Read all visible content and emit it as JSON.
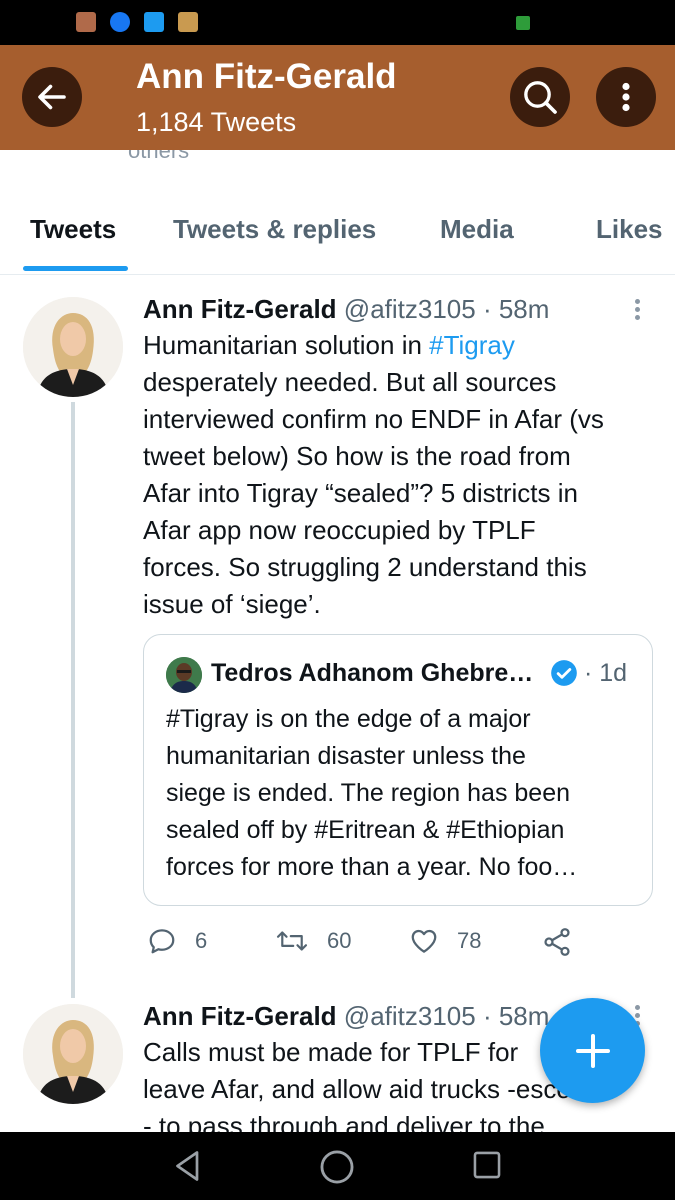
{
  "header": {
    "name": "Ann Fitz-Gerald",
    "tweet_count": "1,184 Tweets"
  },
  "profile_fragment": {
    "text": "others"
  },
  "tabs": [
    {
      "label": "Tweets",
      "active": true
    },
    {
      "label": "Tweets & replies",
      "active": false
    },
    {
      "label": "Media",
      "active": false
    },
    {
      "label": "Likes",
      "active": false
    }
  ],
  "tweets": [
    {
      "author": "Ann Fitz-Gerald",
      "handle": "@afitz3105",
      "meta": "@afitz3105 · 58m",
      "text_before": "Humanitarian solution in ",
      "hashtag": "#Tigray",
      "text_after": "\ndesperately needed. But all sources\ninterviewed confirm no ENDF in Afar (vs\ntweet below) So how is the road from\nAfar into Tigray “sealed”? 5 districts in\nAfar app now reoccupied by TPLF\nforces.  So struggling 2 understand this\nissue of ‘siege’.",
      "quote": {
        "author": "Tedros Adhanom Ghebre…",
        "time": "· 1d",
        "text": "#Tigray is on the edge of a major\nhumanitarian disaster unless the\nsiege is ended. The region has been\nsealed off by #Eritrean & #Ethiopian\nforces for more than a year. No foo…"
      },
      "replies": "6",
      "retweets": "60",
      "likes": "78"
    },
    {
      "author": "Ann Fitz-Gerald",
      "meta": "@afitz3105 · 58m",
      "text": "Calls must be made for TPLF for\nleave Afar, and allow aid trucks -escorted\n- to pass through and deliver to the"
    }
  ],
  "colors": {
    "header_bg": "#a65e2e",
    "accent": "#1d9bf0",
    "status_bar": "#000000"
  },
  "icons": [
    "back-arrow-icon",
    "search-icon",
    "more-vertical-icon",
    "reply-icon",
    "retweet-icon",
    "like-icon",
    "share-icon",
    "compose-plus-icon",
    "verified-badge-icon"
  ]
}
